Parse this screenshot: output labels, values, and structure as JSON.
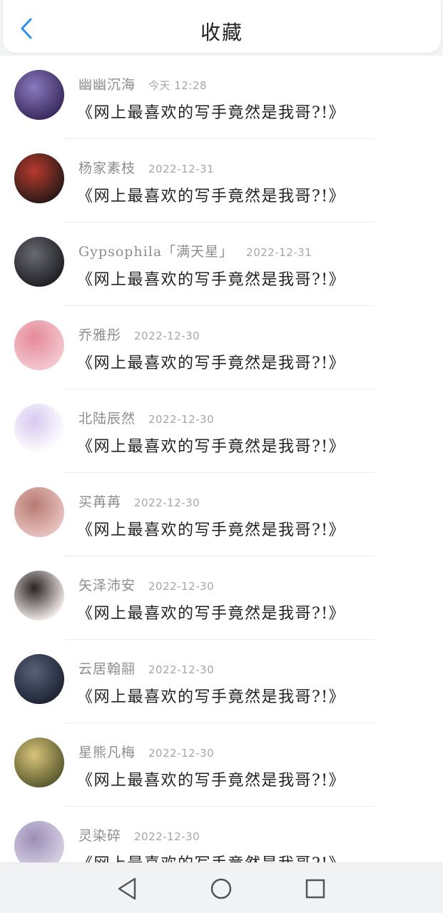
{
  "header": {
    "title": "收藏",
    "back_icon": "chevron-left-icon",
    "accent_color": "#2f8ef0"
  },
  "favorites": [
    {
      "username": "幽幽沉海",
      "time": "今天 12:28",
      "work": "《网上最喜欢的写手竟然是我哥?!》",
      "avatar_colors": [
        "#3a2a5e",
        "#8a7ac0"
      ]
    },
    {
      "username": "杨家素枝",
      "time": "2022-12-31",
      "work": "《网上最喜欢的写手竟然是我哥?!》",
      "avatar_colors": [
        "#2b1a18",
        "#b83a2e"
      ]
    },
    {
      "username": "Gypsophila「满天星」",
      "time": "2022-12-31",
      "work": "《网上最喜欢的写手竟然是我哥?!》",
      "avatar_colors": [
        "#1f1f24",
        "#6a6a74"
      ]
    },
    {
      "username": "乔雅彤",
      "time": "2022-12-30",
      "work": "《网上最喜欢的写手竟然是我哥?!》",
      "avatar_colors": [
        "#f3c7cf",
        "#e58a9a"
      ]
    },
    {
      "username": "北陆辰然",
      "time": "2022-12-30",
      "work": "《网上最喜欢的写手竟然是我哥?!》",
      "avatar_colors": [
        "#ffffff",
        "#d8c8f0"
      ]
    },
    {
      "username": "买苒苒",
      "time": "2022-12-30",
      "work": "《网上最喜欢的写手竟然是我哥?!》",
      "avatar_colors": [
        "#e9c2c0",
        "#b67a70"
      ]
    },
    {
      "username": "矢泽沛安",
      "time": "2022-12-30",
      "work": "《网上最喜欢的写手竟然是我哥?!》",
      "avatar_colors": [
        "#f1e9e7",
        "#2a2324"
      ]
    },
    {
      "username": "云居翰翮",
      "time": "2022-12-30",
      "work": "《网上最喜欢的写手竟然是我哥?!》",
      "avatar_colors": [
        "#1e2433",
        "#58617a"
      ]
    },
    {
      "username": "星熊凡梅",
      "time": "2022-12-30",
      "work": "《网上最喜欢的写手竟然是我哥?!》",
      "avatar_colors": [
        "#5b5a2e",
        "#d9c47a"
      ]
    },
    {
      "username": "灵染碎",
      "time": "2022-12-30",
      "work": "《网上最喜欢的写手竟然是我哥?!》",
      "avatar_colors": [
        "#d7d0e3",
        "#9b8db6"
      ]
    }
  ],
  "navbar": {
    "back_icon": "triangle-back-icon",
    "home_icon": "circle-home-icon",
    "recents_icon": "square-recents-icon"
  }
}
